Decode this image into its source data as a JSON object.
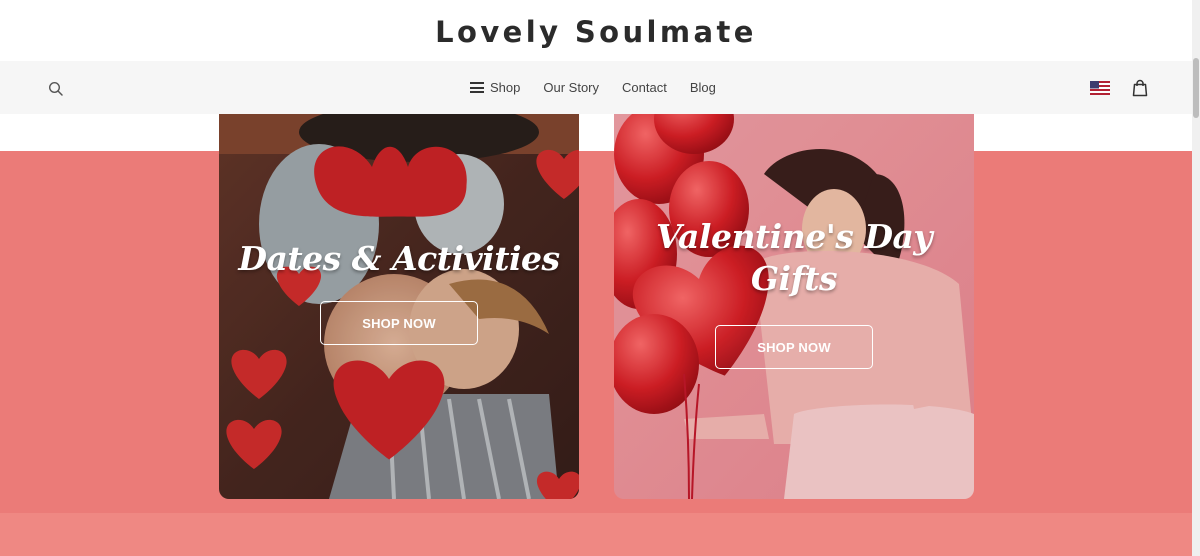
{
  "brand": {
    "name": "Lovely Soulmate"
  },
  "nav": {
    "items": [
      {
        "label": "Shop",
        "icon": "hamburger-icon"
      },
      {
        "label": "Our Story"
      },
      {
        "label": "Contact"
      },
      {
        "label": "Blog"
      }
    ],
    "left_icon": "search-icon",
    "right_icons": [
      "us-flag-icon",
      "shopping-bag-icon"
    ]
  },
  "cards": [
    {
      "title": "Dates & Activities",
      "button": "SHOP NOW"
    },
    {
      "title_line1": "Valentine's Day",
      "title_line2": "Gifts",
      "button": "SHOP NOW"
    }
  ],
  "colors": {
    "hero_band": "#eb7b78",
    "bottom_band": "#ef8883",
    "nav_bg": "#f6f6f6",
    "heart_red": "#d9262a"
  }
}
